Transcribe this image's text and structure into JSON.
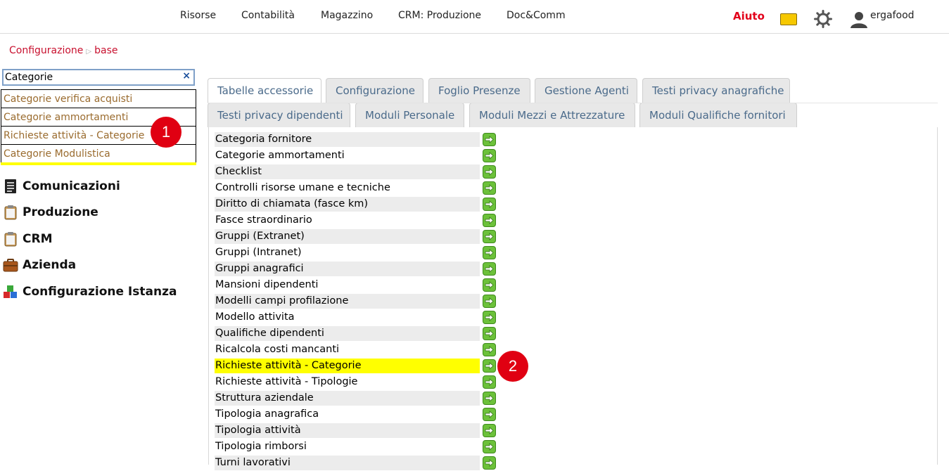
{
  "topnav": {
    "items": [
      "Risorse",
      "Contabilità",
      "Magazzino",
      "CRM: Produzione",
      "Doc&Comm"
    ],
    "help": "Aiuto",
    "user": "ergafood"
  },
  "breadcrumb": {
    "root": "Configurazione",
    "current": "base"
  },
  "search": {
    "value": "Categorie",
    "clear": "×",
    "suggestions": [
      "Categorie verifica acquisti",
      "Categorie ammortamenti",
      "Richieste attività - Categorie",
      "Categorie Modulistica"
    ]
  },
  "badges": [
    "1",
    "2"
  ],
  "menu": [
    "Comunicazioni",
    "Produzione",
    "CRM",
    "Azienda",
    "Configurazione Istanza"
  ],
  "tabs": {
    "row1": [
      "Tabelle accessorie",
      "Configurazione",
      "Foglio Presenze",
      "Gestione Agenti",
      "Testi privacy anagrafiche"
    ],
    "row2": [
      "Testi privacy dipendenti",
      "Moduli Personale",
      "Moduli Mezzi e Attrezzature",
      "Moduli Qualifiche fornitori"
    ],
    "active": "Tabelle accessorie"
  },
  "list": [
    "Categoria fornitore",
    "Categorie ammortamenti",
    "Checklist",
    "Controlli risorse umane e tecniche",
    "Diritto di chiamata (fasce km)",
    "Fasce straordinario",
    "Gruppi (Extranet)",
    "Gruppi (Intranet)",
    "Gruppi anagrafici",
    "Mansioni dipendenti",
    "Modelli campi profilazione",
    "Modello attivita",
    "Qualifiche dipendenti",
    "Ricalcola costi mancanti",
    "Richieste attività - Categorie",
    "Richieste attività - Tipologie",
    "Struttura aziendale",
    "Tipologia anagrafica",
    "Tipologia attività",
    "Tipologia rimborsi",
    "Turni lavorativi"
  ],
  "highlighted_item": "Richieste attività - Categorie",
  "colors": {
    "accent": "#c8102e",
    "highlight": "#ffff00",
    "badge": "#e00012",
    "go_button": "#6cc13a"
  }
}
